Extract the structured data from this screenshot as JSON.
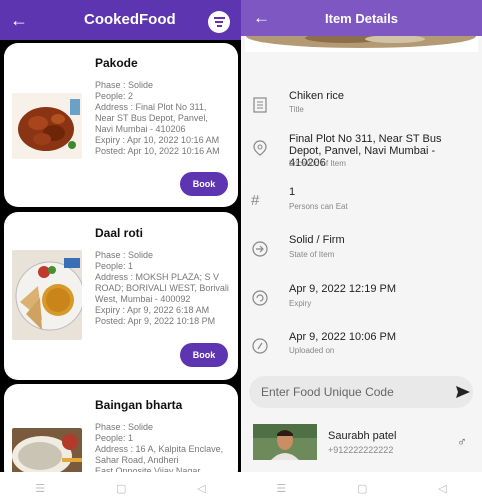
{
  "left": {
    "title": "CookedFood",
    "back_icon": "arrow-left-icon",
    "menu_icon": "filter-menu-icon",
    "cards": [
      {
        "name": "Pakode",
        "phase": "Phase : Solide",
        "people": "People: 2",
        "address_lines": [
          "Address : Final Plot No 311,",
          "Near ST Bus Depot, Panvel,",
          "Navi Mumbai - 410206"
        ],
        "expiry": "Expiry : Apr 10, 2022 10:16 AM",
        "posted": "Posted: Apr 10, 2022 10:16 AM",
        "book": "Book"
      },
      {
        "name": "Daal roti",
        "phase": "Phase : Solide",
        "people": "People: 1",
        "address_lines": [
          "Address : MOKSH PLAZA; S V",
          "ROAD; BORIVALI WEST, Borivali",
          "West, Mumbai - 400092"
        ],
        "expiry": "Expiry : Apr 9, 2022 6:18 AM",
        "posted": "Posted: Apr 9, 2022 10:18 PM",
        "book": "Book"
      },
      {
        "name": "Baingan bharta",
        "phase": "Phase : Solide",
        "people": "People: 1",
        "address_lines": [
          "Address : 16 A, Kalpita Enclave,",
          "Sahar Road, Andheri",
          "East Opposite Vijay Nagar"
        ],
        "expiry": "",
        "posted": "",
        "book": ""
      }
    ]
  },
  "right": {
    "title": "Item Details",
    "back_icon": "arrow-left-icon",
    "rows": [
      {
        "icon": "document-icon",
        "value": "Chiken rice",
        "label": "Title"
      },
      {
        "icon": "location-pin-icon",
        "value": "Final Plot No 311, Near ST Bus Depot, Panvel, Navi Mumbai - 410206",
        "label": "Location of Item"
      },
      {
        "icon": "hash-icon",
        "value": "1",
        "label": "Persons can Eat"
      },
      {
        "icon": "arrow-circle-icon",
        "value": "Solid / Firm",
        "label": "State of Item"
      },
      {
        "icon": "refresh-circle-icon",
        "value": "Apr 9, 2022 12:19 PM",
        "label": "Expiry"
      },
      {
        "icon": "upload-circle-icon",
        "value": "Apr 9, 2022 10:06 PM",
        "label": "Uploaded on"
      }
    ],
    "code_input": {
      "placeholder": "Enter Food Unique Code",
      "value": ""
    },
    "send_icon": "send-icon",
    "user": {
      "name": "Saurabh patel",
      "phone": "+912222222222",
      "gender_icon": "male-icon"
    }
  },
  "colors": {
    "primary": "#5e35b1",
    "appbar_right": "#7e57c2"
  },
  "navbar_icons": [
    "menu-icon",
    "home-square-icon",
    "back-triangle-icon"
  ]
}
